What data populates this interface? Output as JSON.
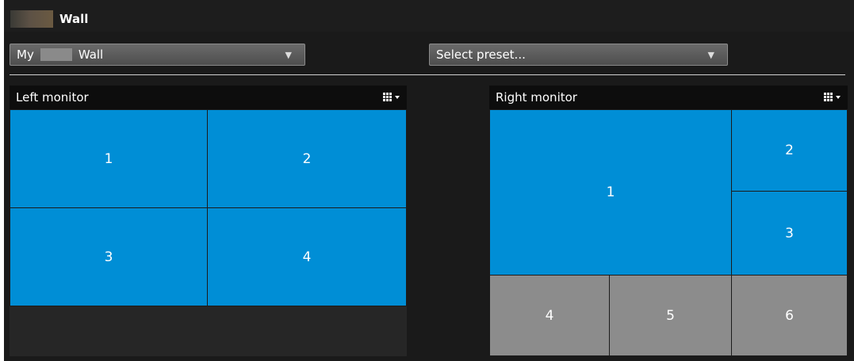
{
  "title": "Wall",
  "wall_select": {
    "prefix": "My",
    "suffix": "Wall"
  },
  "preset_select": {
    "label": "Select preset..."
  },
  "left_monitor": {
    "title": "Left monitor",
    "menu_icon": "grid-menu-icon",
    "tiles": [
      "1",
      "2",
      "3",
      "4"
    ]
  },
  "right_monitor": {
    "title": "Right monitor",
    "menu_icon": "grid-menu-icon",
    "tiles": [
      "1",
      "2",
      "3",
      "4",
      "5",
      "6"
    ]
  },
  "colors": {
    "tile_active": "#008ed6",
    "tile_inactive": "#8c8c8c",
    "background": "#1a1a1a"
  }
}
